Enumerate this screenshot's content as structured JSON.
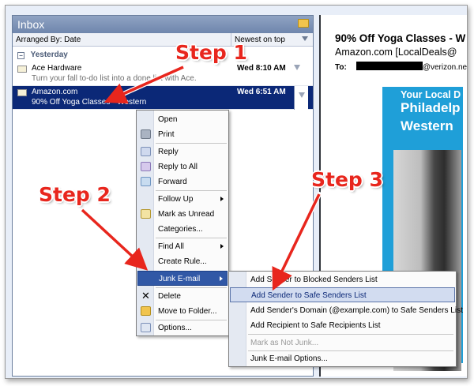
{
  "inbox": {
    "title": "Inbox",
    "arrange_by": "Arranged By: Date",
    "sort_order": "Newest on top",
    "group_label": "Yesterday",
    "group_toggle": "−"
  },
  "messages": [
    {
      "sender": "Ace Hardware",
      "preview": "Turn your fall to-do list into a done list with Ace.",
      "date": "Wed 8:10 AM"
    },
    {
      "sender": "Amazon.com",
      "preview": "90% Off Yoga Classes - Western",
      "date": "Wed 6:51 AM"
    }
  ],
  "reading_pane": {
    "subject": "90% Off Yoga Classes - W",
    "from": "Amazon.com [LocalDeals@",
    "to_label": "To:",
    "to_address": "@verizon.net",
    "ad_line1": "Your Local D",
    "ad_line2": "Philadelp",
    "ad_line3": "Western"
  },
  "context_menu": [
    {
      "label": "Open",
      "icon": "open-icon"
    },
    {
      "label": "Print",
      "icon": "print-icon"
    },
    {
      "label": "Reply",
      "icon": "reply-icon"
    },
    {
      "label": "Reply to All",
      "icon": "reply-all-icon"
    },
    {
      "label": "Forward",
      "icon": "forward-icon"
    },
    {
      "label": "Follow Up",
      "icon": "follow-up-icon"
    },
    {
      "label": "Mark as Unread",
      "icon": "envelope-icon"
    },
    {
      "label": "Categories...",
      "icon": "categories-icon"
    },
    {
      "label": "Find All",
      "icon": "find-icon"
    },
    {
      "label": "Create Rule...",
      "icon": "rule-icon"
    },
    {
      "label": "Junk E-mail",
      "icon": "junk-icon"
    },
    {
      "label": "Delete",
      "icon": "delete-icon"
    },
    {
      "label": "Move to Folder...",
      "icon": "move-icon"
    },
    {
      "label": "Options...",
      "icon": "options-icon"
    }
  ],
  "junk_submenu": [
    {
      "label": "Add Sender to Blocked Senders List"
    },
    {
      "label": "Add Sender to Safe Senders List"
    },
    {
      "label": "Add Sender's Domain (@example.com) to Safe Senders List"
    },
    {
      "label": "Add Recipient to Safe Recipients List"
    },
    {
      "label": "Mark as Not Junk..."
    },
    {
      "label": "Junk E-mail Options..."
    }
  ],
  "annotations": {
    "step1": "Step 1",
    "step2": "Step 2",
    "step3": "Step 3",
    "color": "#e8261d"
  }
}
